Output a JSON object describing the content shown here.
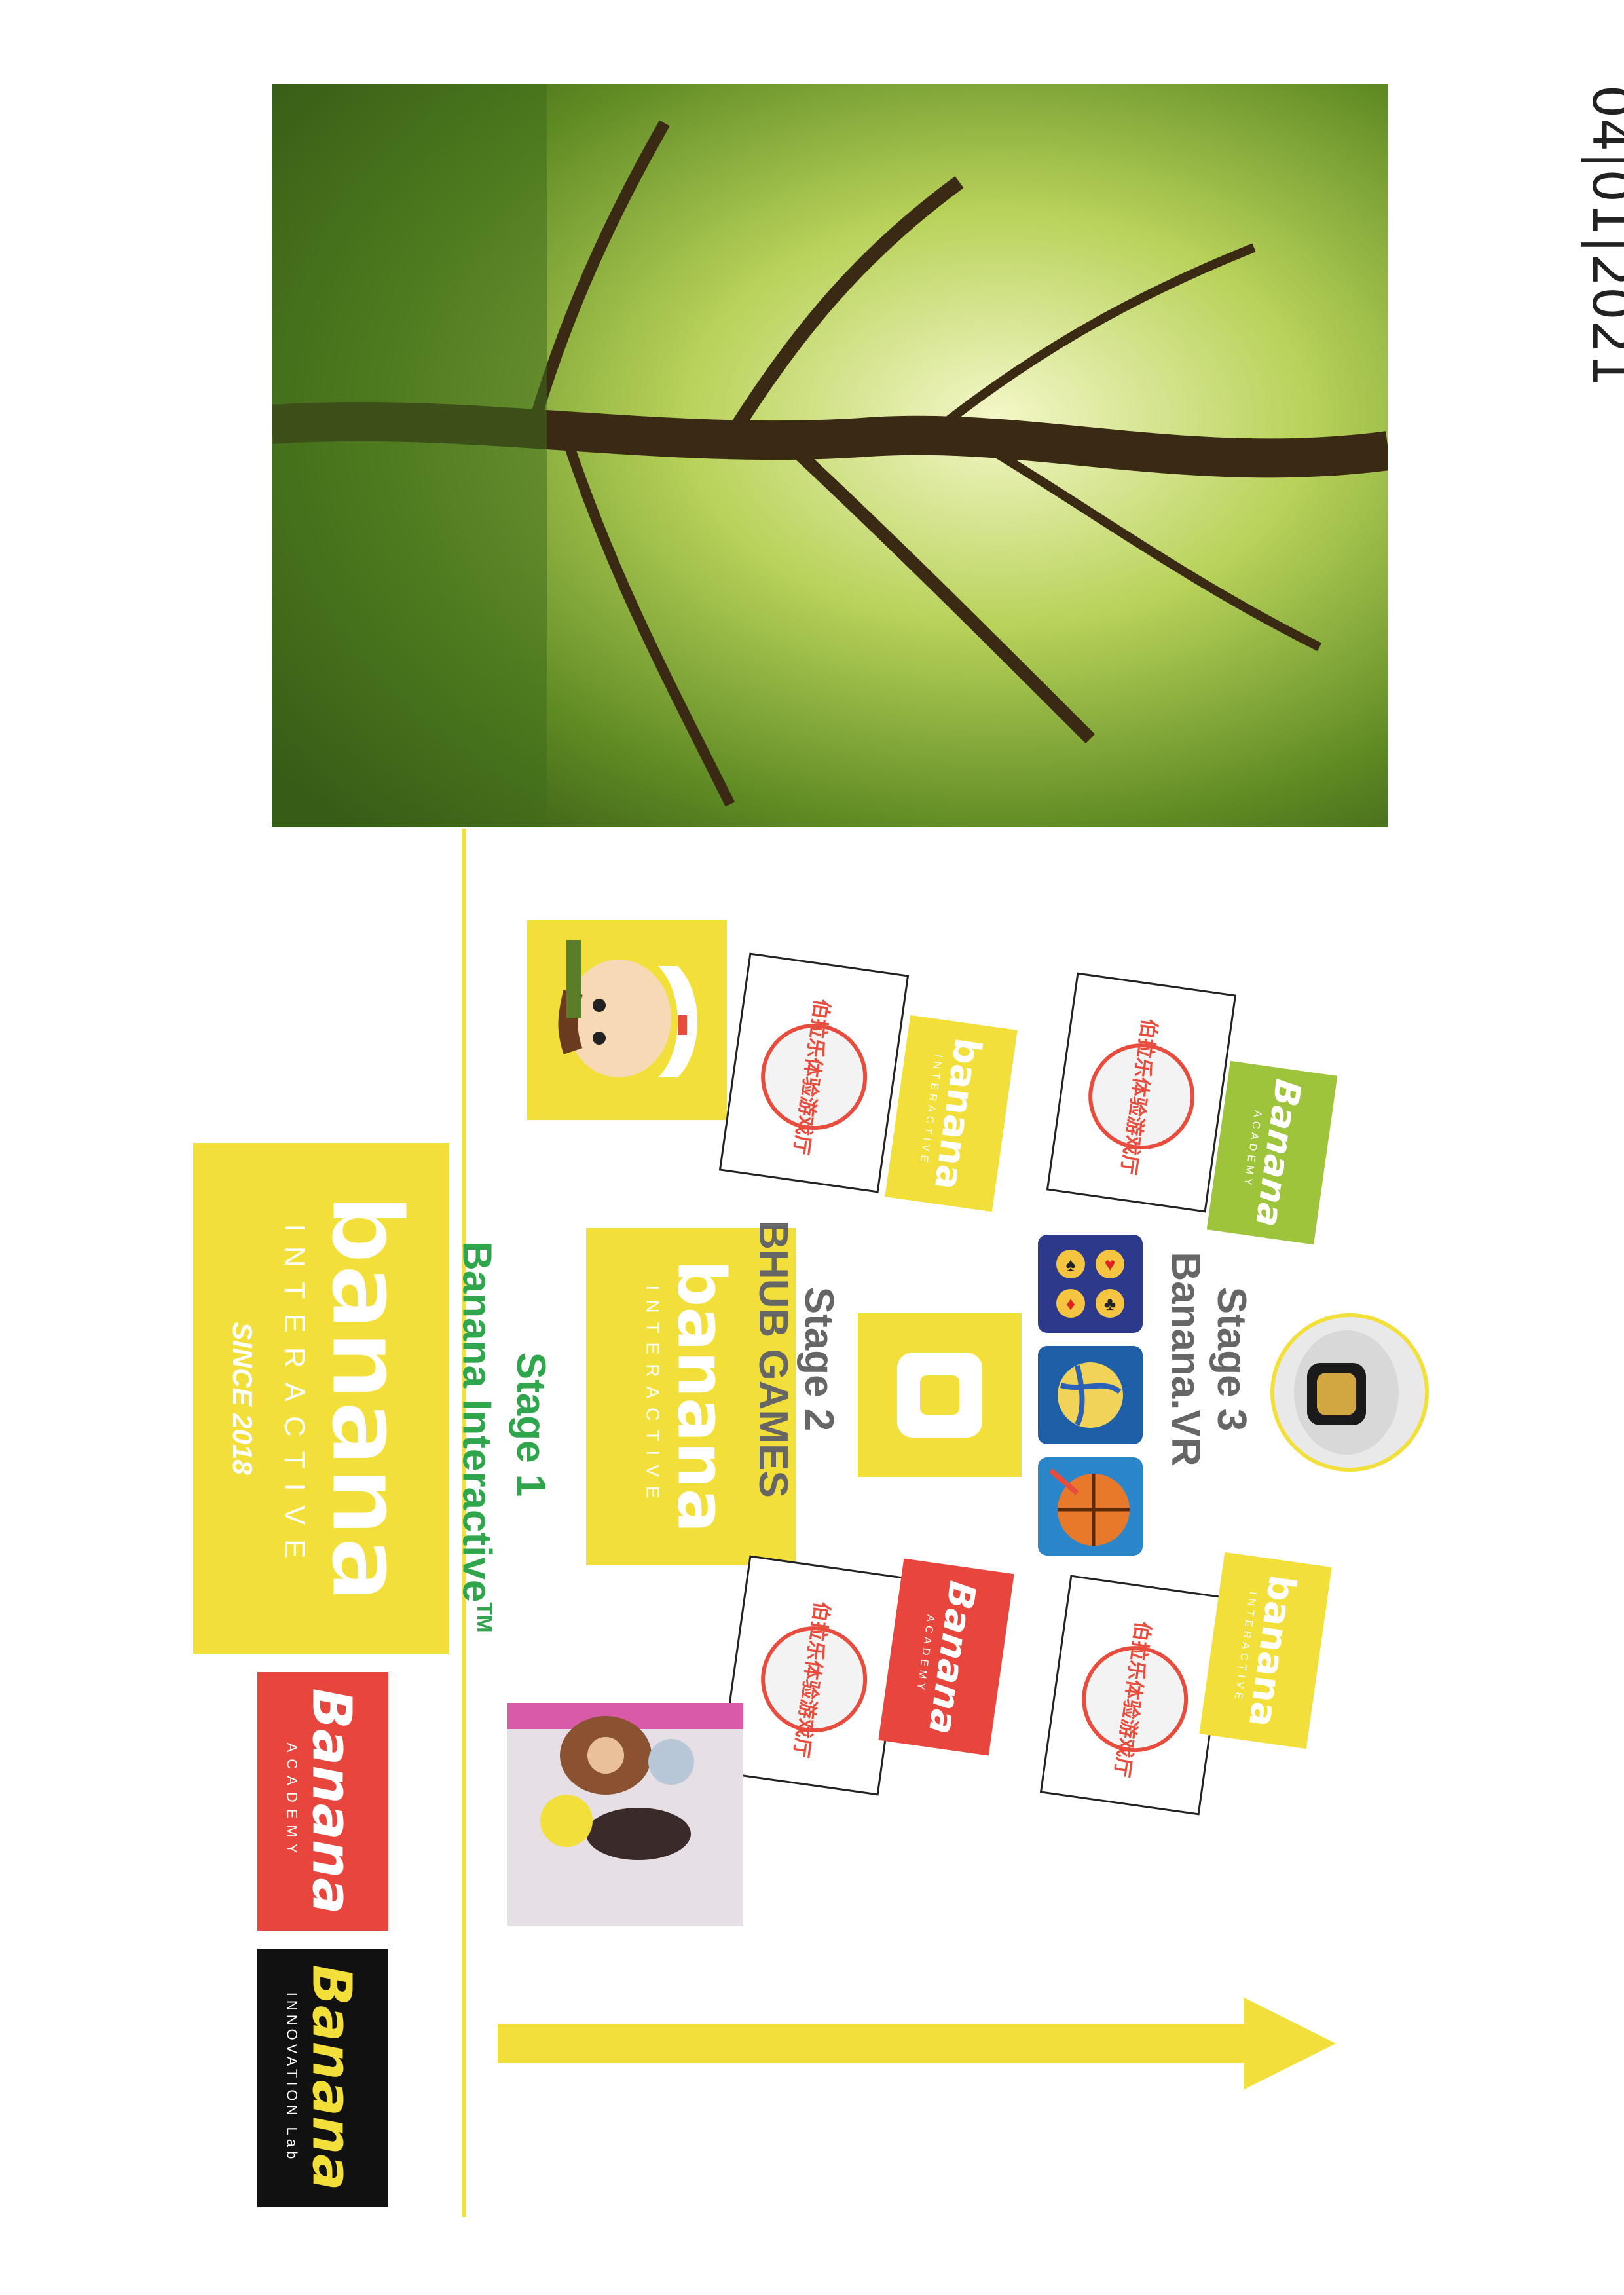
{
  "handwritten_date": "04|01|2021",
  "stage3": {
    "title": "Stage 3",
    "subtitle": "Banana.VR"
  },
  "stage2": {
    "title": "Stage 2",
    "subtitle": "BHUB GAMES"
  },
  "stage1": {
    "title": "Stage 1",
    "subtitle": "Banana Interactive",
    "trademark": "TM"
  },
  "main_logo": {
    "word": "banana",
    "tagline": "INTERACTIVE",
    "since": "SINCE 2018"
  },
  "small_logo": {
    "word": "banana",
    "tagline": "INTERACTIVE"
  },
  "academy_logo": {
    "word": "Banana",
    "tagline": "ACADEMY"
  },
  "innovation_logo": {
    "word": "Banana",
    "tagline": "INNOVATION Lab"
  },
  "chinese_brand": "伯拉乐体验游戏厅",
  "colors": {
    "yellow": "#f2df3a",
    "green": "#2fa64c",
    "red": "#e8453c",
    "olive": "#9ec43c",
    "black": "#111111"
  }
}
